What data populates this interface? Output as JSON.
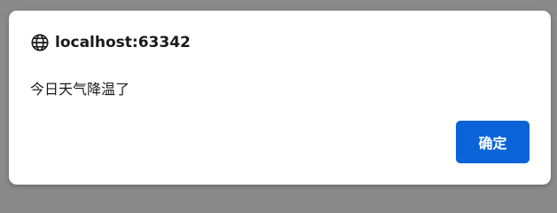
{
  "dialog": {
    "title": "localhost:63342",
    "title_icon": "globe-icon",
    "message": "今日天气降温了",
    "ok_label": "确定",
    "ok_color": "#0b63d8"
  },
  "backdrop_color": "#8a8a8a"
}
